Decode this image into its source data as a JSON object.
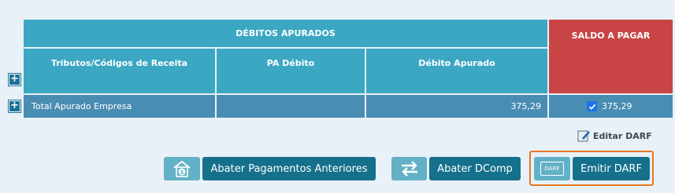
{
  "table": {
    "header_debitos": "DÉBITOS APURADOS",
    "header_saldo": "SALDO A PAGAR",
    "col_tributos": "Tributos/Códigos de Receita",
    "col_pa": "PA Débito",
    "col_debito": "Débito Apurado",
    "expand_symbol": "+",
    "total_row": {
      "label": "Total Apurado Empresa",
      "pa": "",
      "debito": "375,29",
      "saldo": "375,29",
      "saldo_checked": true
    }
  },
  "edit_darf_label": "Editar DARF",
  "buttons": {
    "abater_pagamentos": "Abater Pagamentos Anteriores",
    "abater_dcomp": "Abater DComp",
    "emitir_darf": "Emitir DARF",
    "darf_icon_text": "DARF"
  },
  "colors": {
    "header_blue": "#3ba7c2",
    "saldo_red": "#c94545",
    "row_blue": "#4a8db3",
    "button_dark": "#15708b",
    "button_icon": "#63b1c6",
    "highlight_border": "#e87722"
  }
}
